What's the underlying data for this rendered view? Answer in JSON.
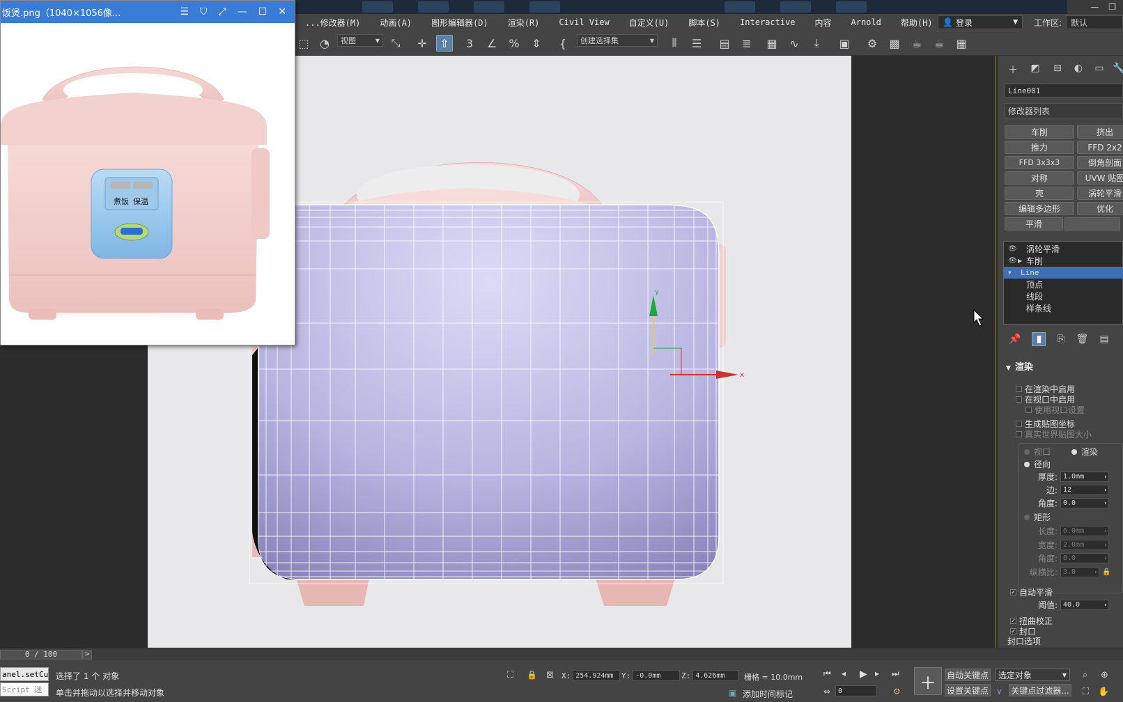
{
  "viewer": {
    "title": "饭煲.png（1040×1056像...",
    "controls": [
      "☰",
      "⛉",
      "⤢",
      "—",
      "☐",
      "✕"
    ],
    "panel_label_cook": "煮饭",
    "panel_label_warm": "保温"
  },
  "menu": {
    "items": [
      "...修改器(M)",
      "动画(A)",
      "图形编辑器(D)",
      "渲染(R)",
      "Civil View",
      "自定义(U)",
      "脚本(S)",
      "Interactive",
      "内容",
      "Arnold",
      "帮助(H)"
    ],
    "login": "登录",
    "workspace_label": "工作区:",
    "workspace_value": "默认"
  },
  "toolbar": {
    "view_dropdown": "视图",
    "selection_set": "创建选择集"
  },
  "command_panel": {
    "object_name": "Line001",
    "modifier_list": "修改器列表",
    "modifier_buttons": [
      [
        "车削",
        "挤出"
      ],
      [
        "推力",
        "FFD 2x2"
      ],
      [
        "FFD 3x3x3",
        "倒角剖面"
      ],
      [
        "对称",
        "UVW 贴图"
      ],
      [
        "壳",
        "涡轮平滑"
      ],
      [
        "编辑多边形",
        "优化"
      ],
      [
        "平滑",
        ""
      ]
    ],
    "stack": [
      "涡轮平滑",
      "车削",
      "Line",
      "顶点",
      "线段",
      "样条线"
    ],
    "rollout_title": "渲染",
    "render_checks": [
      "在渲染中启用",
      "在视口中启用",
      "使用视口设置",
      "生成贴图坐标",
      "真实世界贴图大小"
    ],
    "radio_viewport": "视口",
    "radio_render": "渲染",
    "radio_radial": "径向",
    "thickness_label": "厚度:",
    "thickness": "1.0mm",
    "sides_label": "边:",
    "sides": "12",
    "angle_label": "角度:",
    "angle": "0.0",
    "radio_rect": "矩形",
    "length_label": "长度:",
    "length": "6.0mm",
    "width_label": "宽度:",
    "width": "2.0mm",
    "angle2_label": "角度:",
    "angle2": "0.0",
    "aspect_label": "纵横比:",
    "aspect": "3.0",
    "auto_smooth": "自动平滑",
    "threshold_label": "阈值:",
    "threshold": "40.0",
    "twist_correct": "扭曲校正",
    "cap": "封口",
    "cap_options": "封口选项"
  },
  "timeline": {
    "frame": "0 / 100",
    "next": ">"
  },
  "status": {
    "script_line1": "anel.setCu",
    "script_line2": "Script 迷",
    "selected": "选择了 1 个 对象",
    "hint": "单击并拖动以选择并移动对象",
    "x_label": "X:",
    "x": "254.924mm",
    "y_label": "Y:",
    "y": "-0.0mm",
    "z_label": "Z:",
    "z": "4.626mm",
    "grid": "栅格 = 10.0mm",
    "add_time_tag": "添加时间标记",
    "auto_key": "自动关键点",
    "set_key": "设置关键点",
    "selected_obj": "选定对象",
    "key_filter": "关键点过滤器...",
    "frame_field": "0"
  },
  "colors": {
    "accent": "#3a7bd5",
    "selection": "#3d6fb5",
    "viewport_bg": "#e8e7ea",
    "mesh": "#b8b4e0",
    "cooker_pink": "#f3d1cf"
  }
}
